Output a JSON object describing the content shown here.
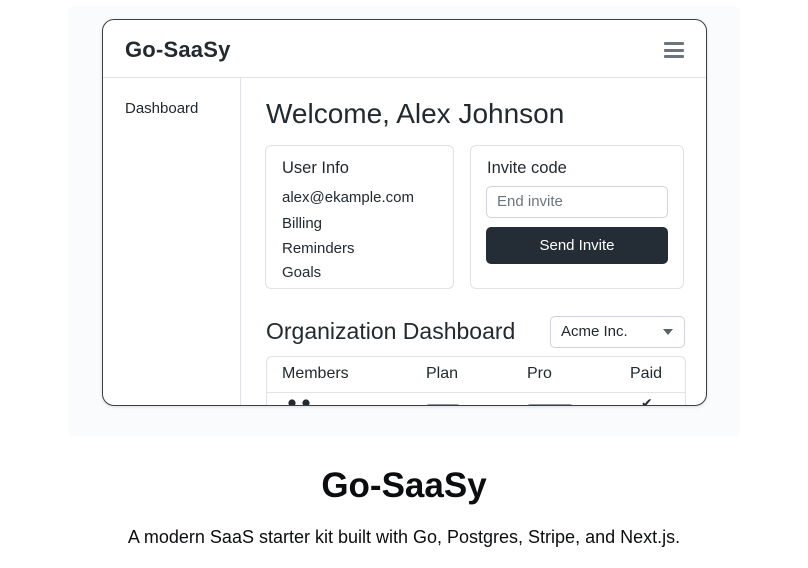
{
  "app": {
    "brand": "Go-SaaSy",
    "menu_icon": "hamburger-menu-icon"
  },
  "sidebar": {
    "items": [
      {
        "label": "Dashboard"
      }
    ]
  },
  "main": {
    "welcome": "Welcome, Alex Johnson",
    "user_info": {
      "title": "User Info",
      "email": "alex@ekample.com",
      "links": [
        "Billing",
        "Reminders",
        "Goals"
      ]
    },
    "invite": {
      "title": "Invite code",
      "input_placeholder": "End invite",
      "button_label": "Send Invite"
    },
    "org": {
      "title": "Organization Dashboard",
      "selected": "Acme Inc."
    },
    "table": {
      "columns": [
        "Members",
        "Plan",
        "Pro",
        "Paid"
      ],
      "row": {
        "member_icon": "people-icon",
        "paid_icon": "checkmark-icon",
        "paid": "✔"
      }
    }
  },
  "hero": {
    "title": "Go-SaaSy",
    "subtitle": "A modern SaaS starter kit built with Go, Postgres, Stripe, and Next.js."
  },
  "colors": {
    "primary_button": "#242d36",
    "border": "#dfe3e7",
    "muted": "#6c757d"
  }
}
